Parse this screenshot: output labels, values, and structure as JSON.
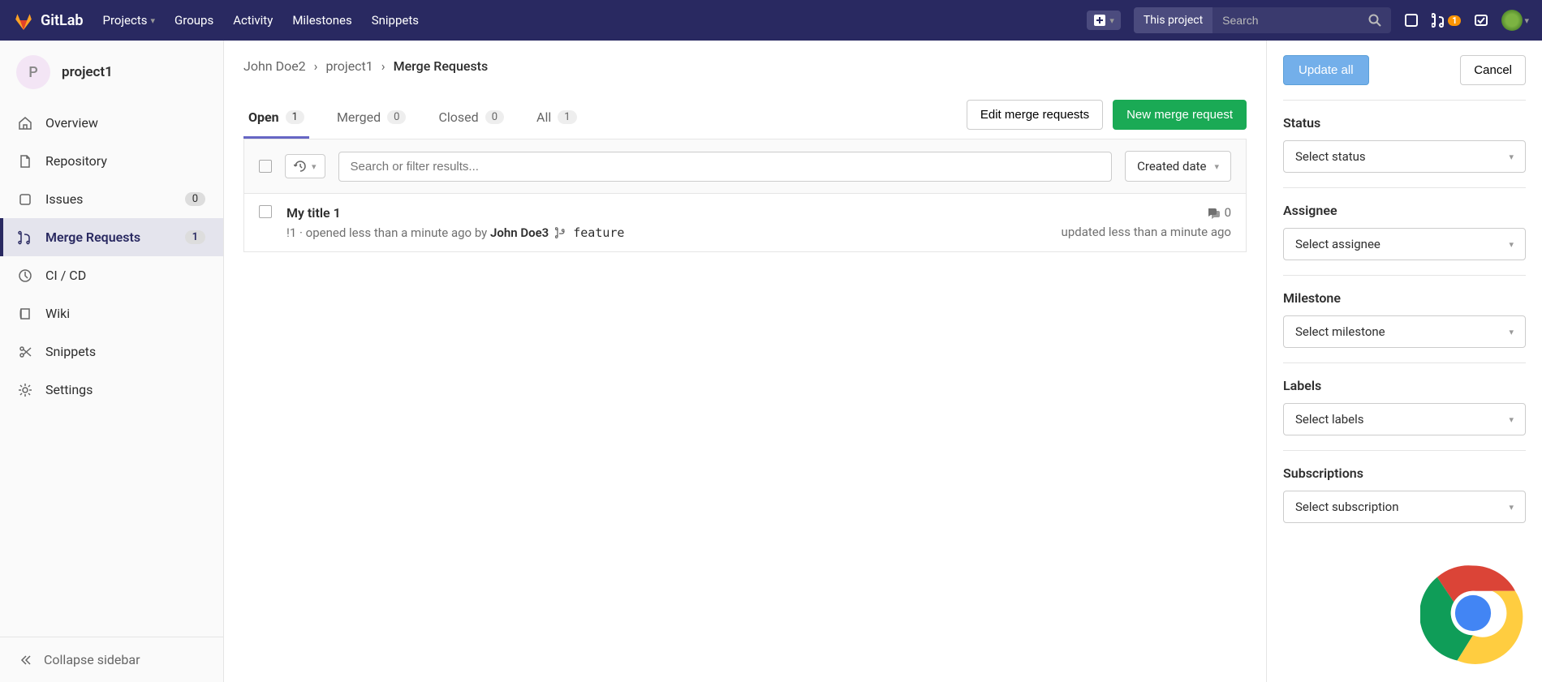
{
  "header": {
    "brand": "GitLab",
    "nav": [
      "Projects",
      "Groups",
      "Activity",
      "Milestones",
      "Snippets"
    ],
    "search_scope": "This project",
    "search_placeholder": "Search",
    "mr_badge": "1"
  },
  "project": {
    "initial": "P",
    "name": "project1"
  },
  "sidebar": {
    "items": [
      {
        "label": "Overview"
      },
      {
        "label": "Repository"
      },
      {
        "label": "Issues",
        "count": "0"
      },
      {
        "label": "Merge Requests",
        "count": "1"
      },
      {
        "label": "CI / CD"
      },
      {
        "label": "Wiki"
      },
      {
        "label": "Snippets"
      },
      {
        "label": "Settings"
      }
    ],
    "collapse": "Collapse sidebar"
  },
  "breadcrumb": {
    "user": "John Doe2",
    "project": "project1",
    "page": "Merge Requests"
  },
  "tabs": {
    "open": {
      "label": "Open",
      "count": "1"
    },
    "merged": {
      "label": "Merged",
      "count": "0"
    },
    "closed": {
      "label": "Closed",
      "count": "0"
    },
    "all": {
      "label": "All",
      "count": "1"
    },
    "edit": "Edit merge requests",
    "new": "New merge request"
  },
  "filter": {
    "placeholder": "Search or filter results...",
    "sort": "Created date"
  },
  "mr": {
    "title": "My title 1",
    "ref": "!1",
    "opened_prefix": " · opened less than a minute ago by ",
    "author": "John Doe3",
    "branch": "feature",
    "updated": "updated less than a minute ago",
    "comments": "0"
  },
  "bulk": {
    "update": "Update all",
    "cancel": "Cancel",
    "status": {
      "label": "Status",
      "placeholder": "Select status"
    },
    "assignee": {
      "label": "Assignee",
      "placeholder": "Select assignee"
    },
    "milestone": {
      "label": "Milestone",
      "placeholder": "Select milestone"
    },
    "labels": {
      "label": "Labels",
      "placeholder": "Select labels"
    },
    "subscriptions": {
      "label": "Subscriptions",
      "placeholder": "Select subscription"
    }
  }
}
